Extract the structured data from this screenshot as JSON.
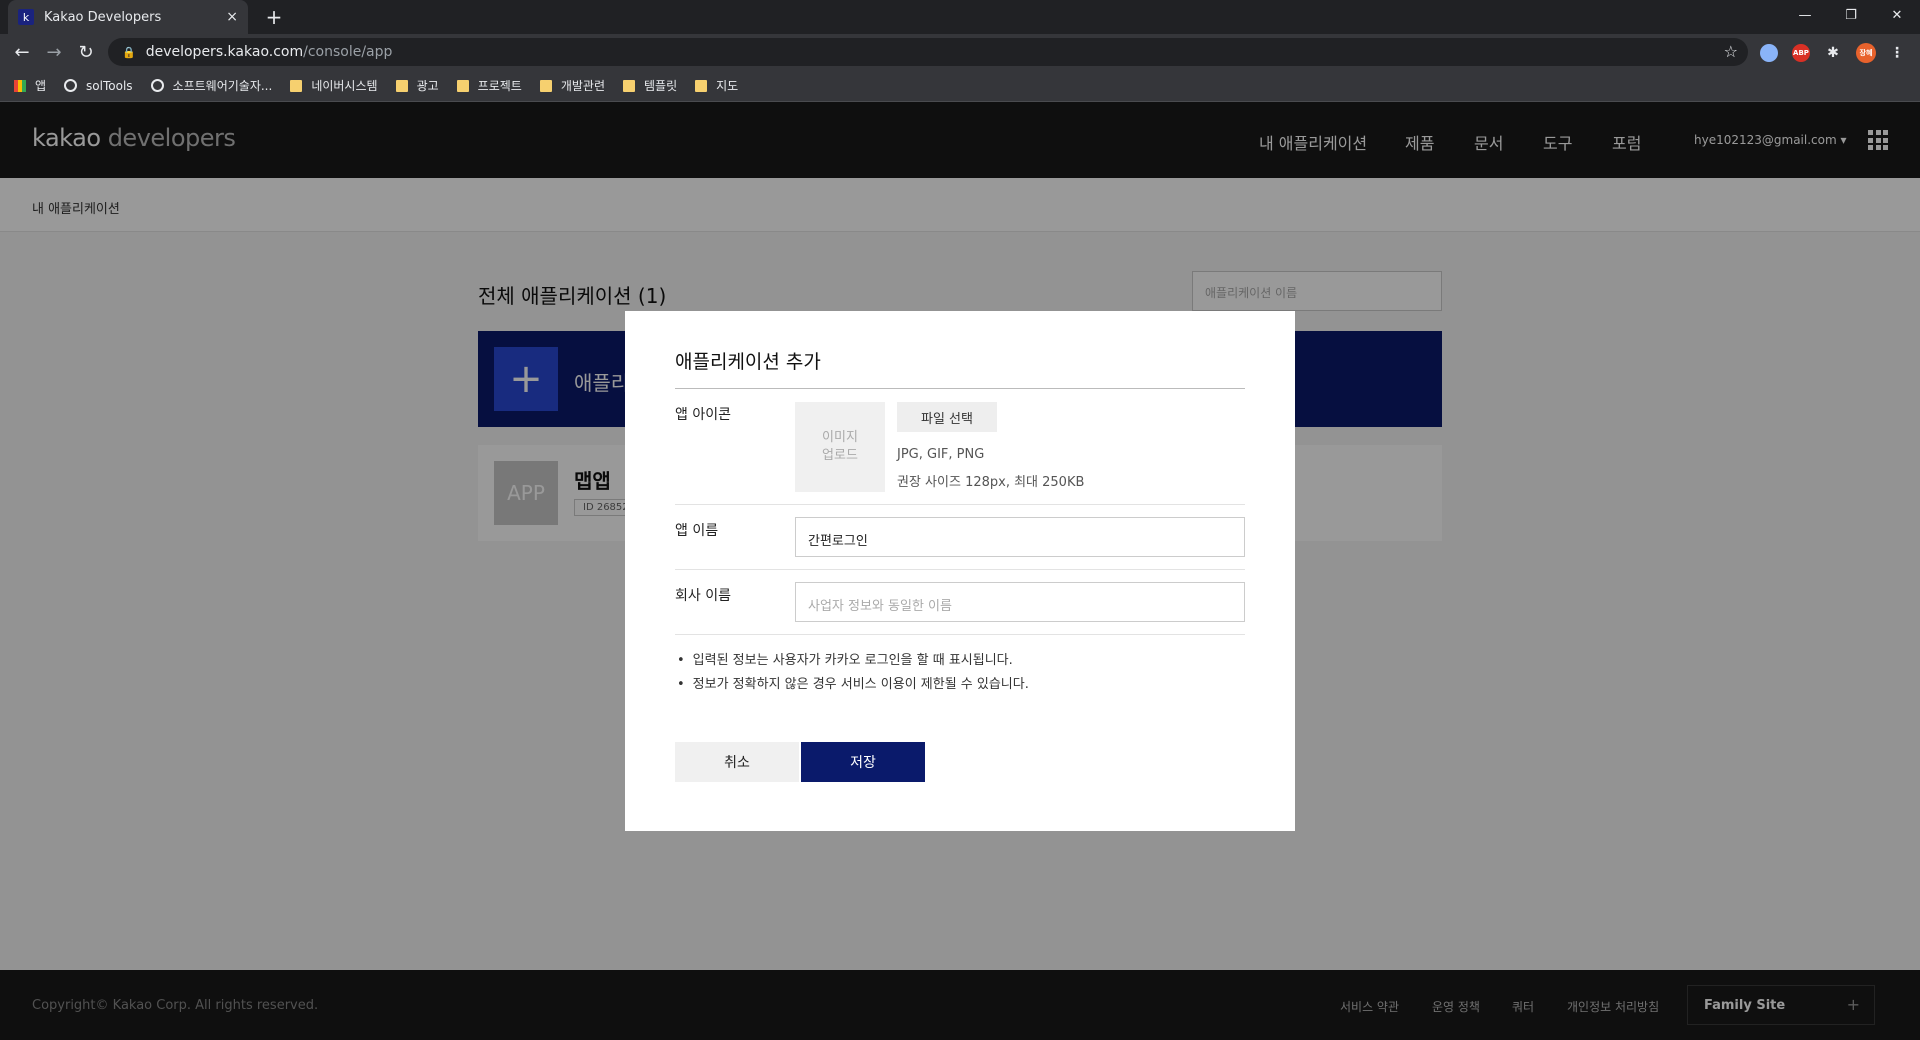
{
  "browser": {
    "tab_title": "Kakao Developers",
    "tab_favicon": "k",
    "tab_close": "×",
    "new_tab": "+",
    "url_host": "developers.kakao.com",
    "url_path": "/console/app",
    "bookmarks": [
      "앱",
      "solTools",
      "소프트웨어기술자...",
      "네이버시스템",
      "광고",
      "프로젝트",
      "개발관련",
      "템플릿",
      "지도"
    ],
    "ext_abp": "ABP",
    "profile": "장혜"
  },
  "gnb": {
    "logo_a": "kakao",
    "logo_b": " developers",
    "nav": [
      "내 애플리케이션",
      "제품",
      "문서",
      "도구",
      "포럼"
    ],
    "user": "hye102123@gmail.com"
  },
  "breadcrumb": "내 애플리케이션",
  "main": {
    "heading": "전체 애플리케이션 (1)",
    "search_placeholder": "애플리케이션 이름",
    "add_label": "애플리",
    "app_thumb": "APP",
    "app_name": "맵앱",
    "app_id": "ID 26852"
  },
  "modal": {
    "title": "애플리케이션 추가",
    "icon_label": "앱 아이콘",
    "image_upload_1": "이미지",
    "image_upload_2": "업로드",
    "file_button": "파일 선택",
    "hint_1": "JPG, GIF, PNG",
    "hint_2": "권장 사이즈 128px, 최대 250KB",
    "name_label": "앱 이름",
    "name_value": "간편로그인",
    "company_label": "회사 이름",
    "company_placeholder": "사업자 정보와 동일한 이름",
    "note_1": "입력된 정보는 사용자가 카카오 로그인을 할 때 표시됩니다.",
    "note_2": "정보가 정확하지 않은 경우 서비스 이용이 제한될 수 있습니다.",
    "cancel": "취소",
    "save": "저장"
  },
  "footer": {
    "copyright": "Copyright© Kakao Corp. All rights reserved.",
    "links": [
      "서비스 약관",
      "운영 정책",
      "쿼터",
      "개인정보 처리방침"
    ],
    "family_site": "Family Site"
  }
}
